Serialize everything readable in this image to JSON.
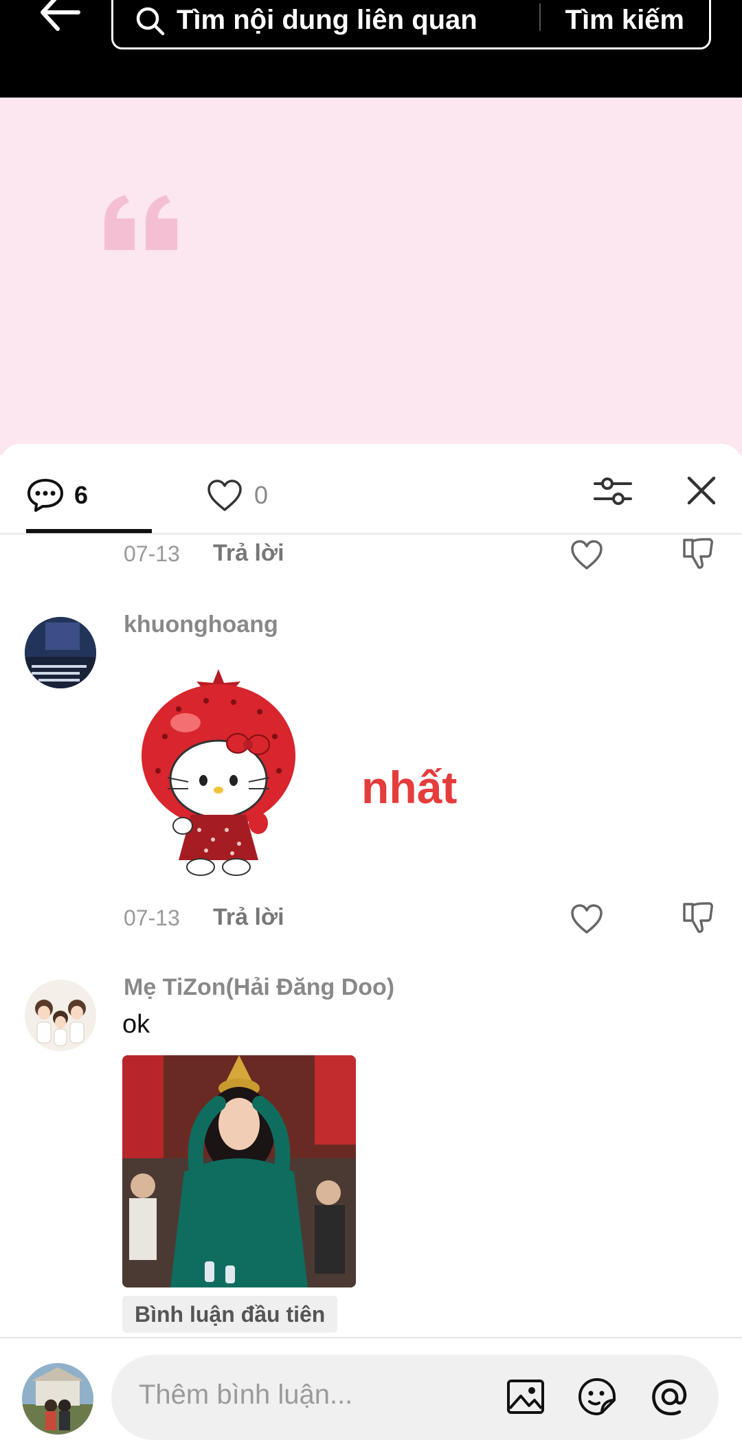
{
  "search": {
    "query": "Tìm nội dung liên quan",
    "submit_label": "Tìm kiếm"
  },
  "tabs": {
    "comments_count": "6",
    "likes_count": "0"
  },
  "comments": [
    {
      "date": "07-13",
      "reply_label": "Trả lời"
    },
    {
      "username": "khuonghoang",
      "sticker_text": "nhất",
      "date": "07-13",
      "reply_label": "Trả lời"
    },
    {
      "username": "Mẹ TiZon(Hải Đăng Doo)",
      "text": "ok",
      "badge": "Bình luận đầu tiên"
    }
  ],
  "composer": {
    "placeholder": "Thêm bình luận..."
  },
  "colors": {
    "pink_bg": "#fce6ef",
    "accent_red": "#e53c3c"
  }
}
